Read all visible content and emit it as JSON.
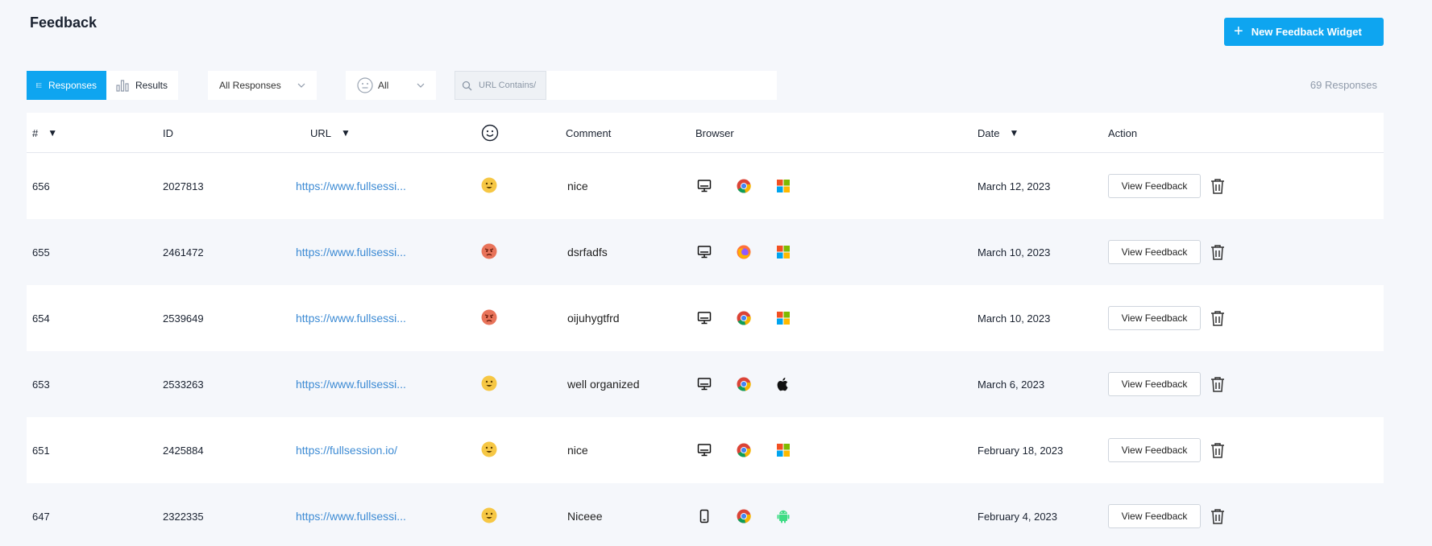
{
  "header": {
    "title": "Feedback",
    "new_widget_label": "New Feedback Widget"
  },
  "toolbar": {
    "tab_responses": "Responses",
    "tab_results": "Results",
    "filter_responses": "All Responses",
    "filter_sentiment": "All",
    "url_label": "URL Contains/",
    "url_value": "",
    "response_count": "69 Responses"
  },
  "table": {
    "columns": {
      "num": "#",
      "id": "ID",
      "url": "URL",
      "comment": "Comment",
      "browser": "Browser",
      "date": "Date",
      "action": "Action"
    },
    "view_label": "View Feedback",
    "rows": [
      {
        "num": "656",
        "id": "2027813",
        "url": "https://www.fullsessi...",
        "sentiment": "happy",
        "comment": "nice",
        "device": "desktop",
        "browser": "chrome",
        "os": "windows",
        "date": "March 12, 2023"
      },
      {
        "num": "655",
        "id": "2461472",
        "url": "https://www.fullsessi...",
        "sentiment": "angry",
        "comment": "dsrfadfs",
        "device": "desktop",
        "browser": "firefox",
        "os": "windows",
        "date": "March 10, 2023"
      },
      {
        "num": "654",
        "id": "2539649",
        "url": "https://www.fullsessi...",
        "sentiment": "angry",
        "comment": "oijuhygtfrd",
        "device": "desktop",
        "browser": "chrome",
        "os": "windows",
        "date": "March 10, 2023"
      },
      {
        "num": "653",
        "id": "2533263",
        "url": "https://www.fullsessi...",
        "sentiment": "happy",
        "comment": "well organized",
        "device": "desktop",
        "browser": "chrome",
        "os": "apple",
        "date": "March 6, 2023"
      },
      {
        "num": "651",
        "id": "2425884",
        "url": "https://fullsession.io/",
        "sentiment": "happy",
        "comment": "nice",
        "device": "desktop",
        "browser": "chrome",
        "os": "windows",
        "date": "February 18, 2023"
      },
      {
        "num": "647",
        "id": "2322335",
        "url": "https://www.fullsessi...",
        "sentiment": "happy",
        "comment": "Niceee",
        "device": "mobile",
        "browser": "chrome",
        "os": "android",
        "date": "February 4, 2023"
      }
    ]
  },
  "colors": {
    "accent": "#0ea5f0",
    "link": "#3d8bd4",
    "happy": "#f6c744",
    "angry": "#e8735a"
  }
}
